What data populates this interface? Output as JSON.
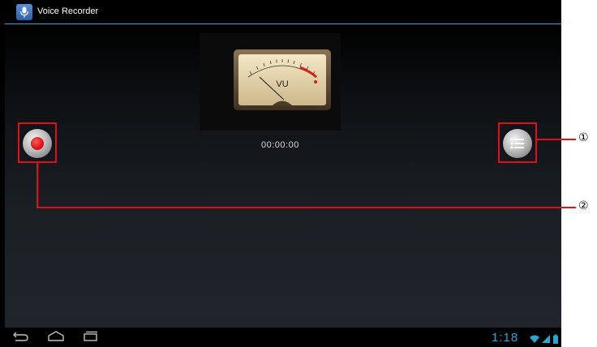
{
  "app": {
    "title": "Voice Recorder",
    "icon": "microphone-icon"
  },
  "recorder": {
    "meter_label": "VU",
    "elapsed_time": "00:00:00"
  },
  "controls": {
    "record_icon": "record-icon",
    "list_icon": "list-icon"
  },
  "system_bar": {
    "clock": "1:18",
    "nav_icons": [
      "back-icon",
      "home-icon",
      "recent-apps-icon"
    ],
    "status_icons": [
      "wifi-icon",
      "signal-icon",
      "battery-icon"
    ]
  },
  "callouts": {
    "list_marker": "①",
    "record_marker": "②"
  },
  "colors": {
    "accent": "#2aa3d5",
    "highlight": "#e10f1a",
    "record": "#e01818"
  }
}
